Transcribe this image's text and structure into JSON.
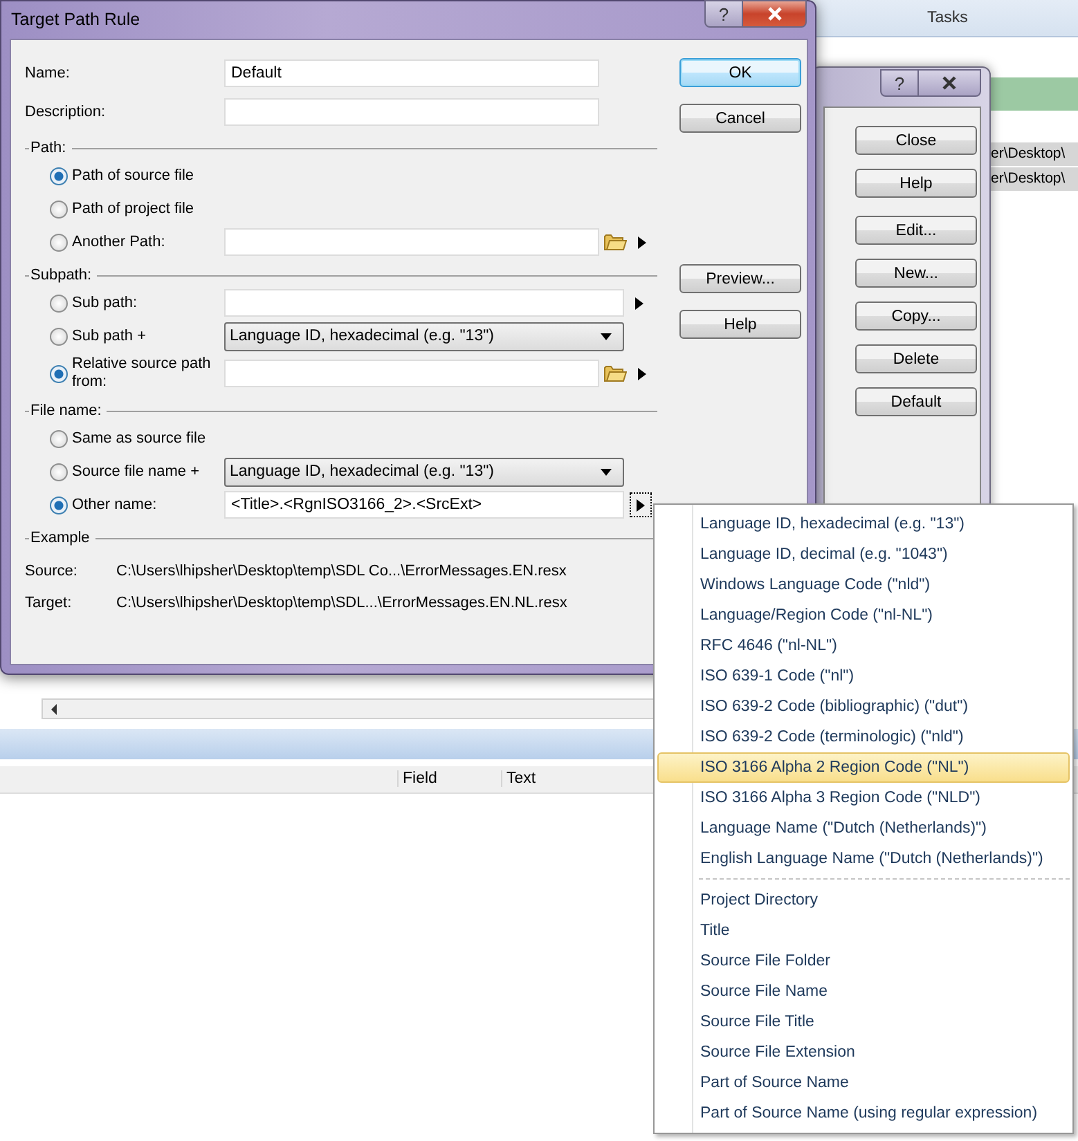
{
  "background_app": {
    "tasks_label": "Tasks",
    "path_cells": [
      "er\\Desktop\\",
      "er\\Desktop\\"
    ],
    "columns": [
      "Field",
      "Text"
    ]
  },
  "rules_dialog": {
    "help_glyph": "?",
    "buttons": [
      "Close",
      "Help",
      "Edit...",
      "New...",
      "Copy...",
      "Delete",
      "Default"
    ]
  },
  "dialog": {
    "title": "Target Path Rule",
    "help_glyph": "?",
    "name": {
      "label": "Name:",
      "value": "Default"
    },
    "description": {
      "label": "Description:"
    },
    "sections": [
      {
        "title": "Path:",
        "options": [
          {
            "label": "Path of source file",
            "selected": true,
            "kind": "none"
          },
          {
            "label": "Path of project file",
            "selected": false,
            "kind": "none"
          },
          {
            "label": "Another Path:",
            "selected": false,
            "kind": "browse"
          }
        ]
      },
      {
        "title": "Subpath:",
        "options": [
          {
            "label": "Sub path:",
            "selected": false,
            "kind": "text"
          },
          {
            "label": "Sub path +",
            "selected": false,
            "kind": "dropdown",
            "value": "Language ID, hexadecimal (e.g. \"13\")"
          },
          {
            "label": "Relative source path from:",
            "selected": true,
            "kind": "browse"
          }
        ]
      },
      {
        "title": "File name:",
        "options": [
          {
            "label": "Same as source file",
            "selected": false,
            "kind": "none"
          },
          {
            "label": "Source file name +",
            "selected": false,
            "kind": "dropdown",
            "value": "Language ID, hexadecimal (e.g. \"13\")"
          },
          {
            "label": "Other name:",
            "selected": true,
            "kind": "name",
            "value": "<Title>.<RgnISO3166_2>.<SrcExt>"
          }
        ]
      }
    ],
    "example": {
      "title": "Example",
      "rows": [
        {
          "label": "Source:",
          "value": "C:\\Users\\lhipsher\\Desktop\\temp\\SDL Co...\\ErrorMessages.EN.resx"
        },
        {
          "label": "Target:",
          "value": "C:\\Users\\lhipsher\\Desktop\\temp\\SDL...\\ErrorMessages.EN.NL.resx"
        }
      ]
    },
    "buttons": [
      {
        "label": "OK",
        "focused": true
      },
      {
        "label": "Cancel",
        "focused": false
      }
    ],
    "side_buttons": [
      {
        "label": "Preview...",
        "focused": false
      },
      {
        "label": "Help",
        "focused": false
      }
    ]
  },
  "menu": {
    "items": [
      {
        "kind": "item",
        "label": "Language ID, hexadecimal (e.g. \"13\")",
        "selected": false
      },
      {
        "kind": "item",
        "label": "Language ID, decimal (e.g. \"1043\")",
        "selected": false
      },
      {
        "kind": "item",
        "label": "Windows Language Code (\"nld\")",
        "selected": false
      },
      {
        "kind": "item",
        "label": "Language/Region Code (\"nl-NL\")",
        "selected": false
      },
      {
        "kind": "item",
        "label": "RFC 4646 (\"nl-NL\")",
        "selected": false
      },
      {
        "kind": "item",
        "label": "ISO 639-1 Code (\"nl\")",
        "selected": false
      },
      {
        "kind": "item",
        "label": "ISO 639-2 Code (bibliographic) (\"dut\")",
        "selected": false
      },
      {
        "kind": "item",
        "label": "ISO 639-2 Code (terminologic) (\"nld\")",
        "selected": false
      },
      {
        "kind": "item",
        "label": "ISO 3166 Alpha 2 Region Code (\"NL\")",
        "selected": true
      },
      {
        "kind": "item",
        "label": "ISO 3166 Alpha 3 Region Code (\"NLD\")",
        "selected": false
      },
      {
        "kind": "item",
        "label": "Language Name (\"Dutch (Netherlands)\")",
        "selected": false
      },
      {
        "kind": "item",
        "label": "English Language Name (\"Dutch (Netherlands)\")",
        "selected": false
      },
      {
        "kind": "separator"
      },
      {
        "kind": "item",
        "label": "Project Directory",
        "selected": false
      },
      {
        "kind": "item",
        "label": "Title",
        "selected": false
      },
      {
        "kind": "item",
        "label": "Source File Folder",
        "selected": false
      },
      {
        "kind": "item",
        "label": "Source File Name",
        "selected": false
      },
      {
        "kind": "item",
        "label": "Source File Title",
        "selected": false
      },
      {
        "kind": "item",
        "label": "Source File Extension",
        "selected": false
      },
      {
        "kind": "item",
        "label": "Part of Source Name",
        "selected": false
      },
      {
        "kind": "item",
        "label": "Part of Source Name (using regular expression)",
        "selected": false
      }
    ]
  }
}
